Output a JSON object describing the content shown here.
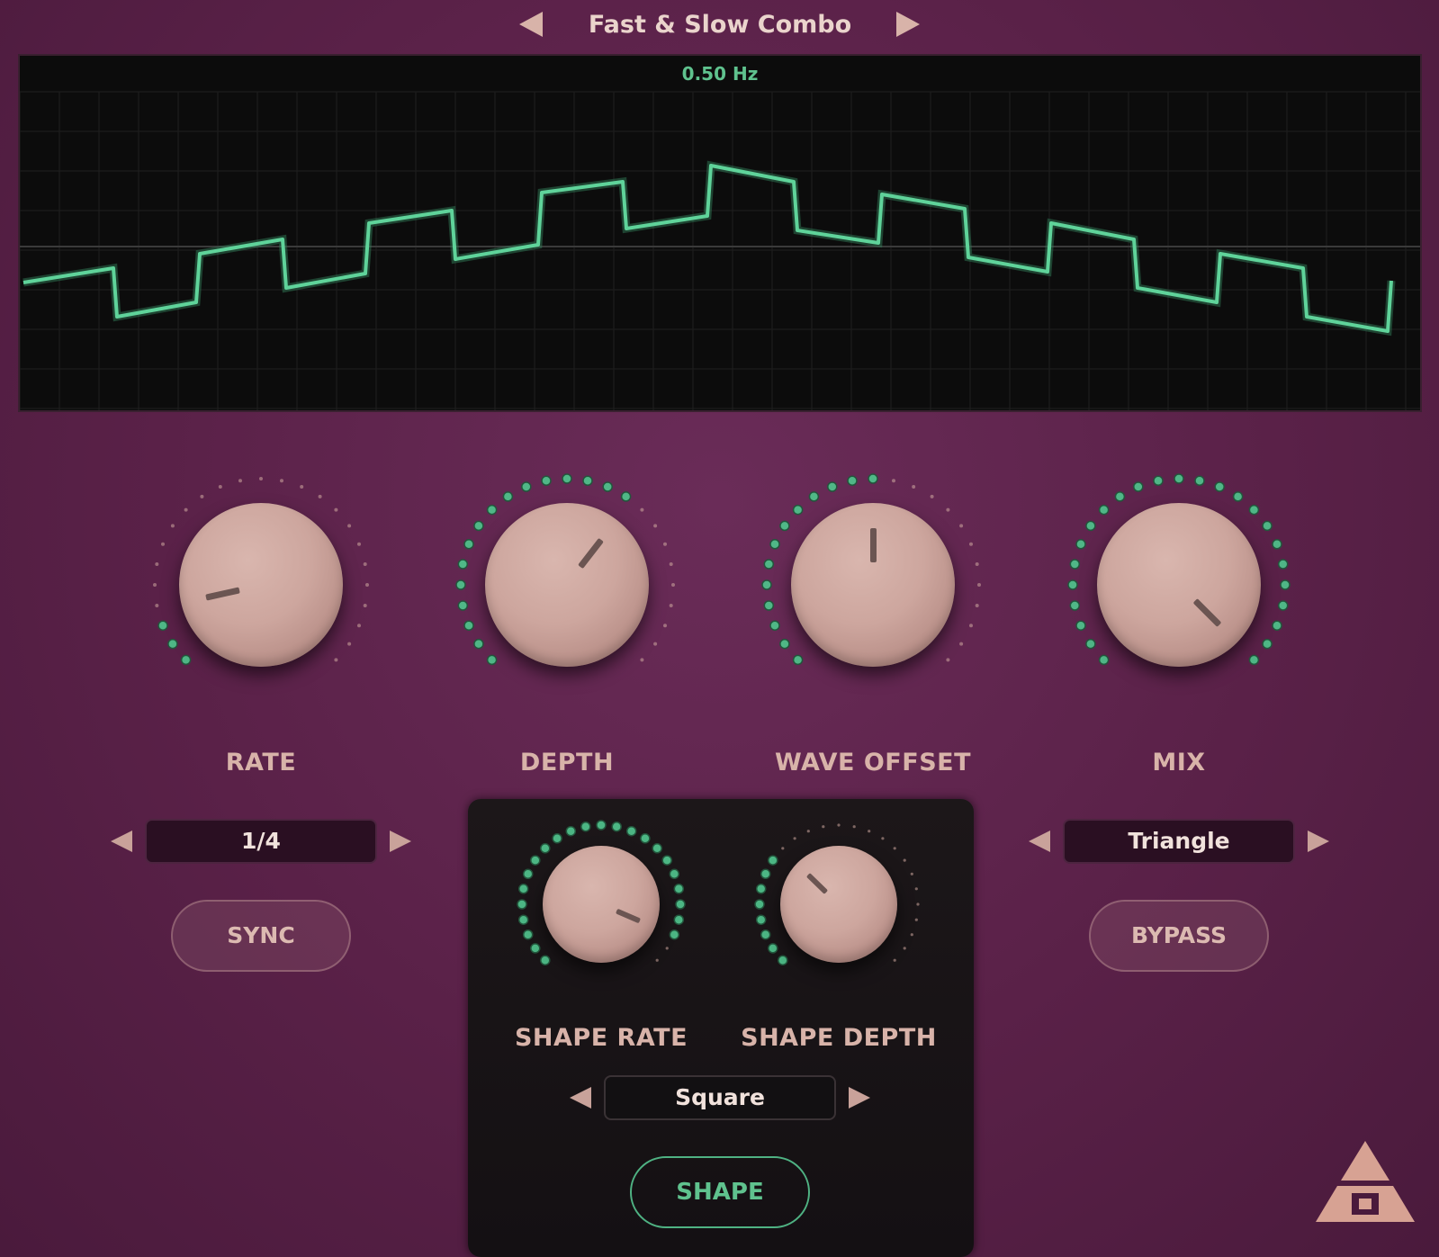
{
  "preset": {
    "name": "Fast & Slow Combo"
  },
  "display": {
    "frequency": "0.50 Hz",
    "wave_color": "#5fd39a"
  },
  "knobs": {
    "rate": {
      "label": "RATE",
      "value": 0.12
    },
    "depth": {
      "label": "DEPTH",
      "value": 0.64
    },
    "wave_offset": {
      "label": "WAVE OFFSET",
      "value": 0.5
    },
    "mix": {
      "label": "MIX",
      "value": 1.0
    },
    "shape_rate": {
      "label": "SHAPE RATE",
      "value": 0.92
    },
    "shape_depth": {
      "label": "SHAPE DEPTH",
      "value": 0.33
    }
  },
  "rate_division": {
    "value": "1/4"
  },
  "sync_button": {
    "label": "SYNC"
  },
  "waveform_select": {
    "value": "Triangle"
  },
  "bypass_button": {
    "label": "BYPASS"
  },
  "shape_select": {
    "value": "Square"
  },
  "shape_button": {
    "label": "SHAPE"
  },
  "colors": {
    "background": "#5a2148",
    "accent": "#5fc28e",
    "knob": "#cda69e",
    "text": "#d8b3a9"
  }
}
